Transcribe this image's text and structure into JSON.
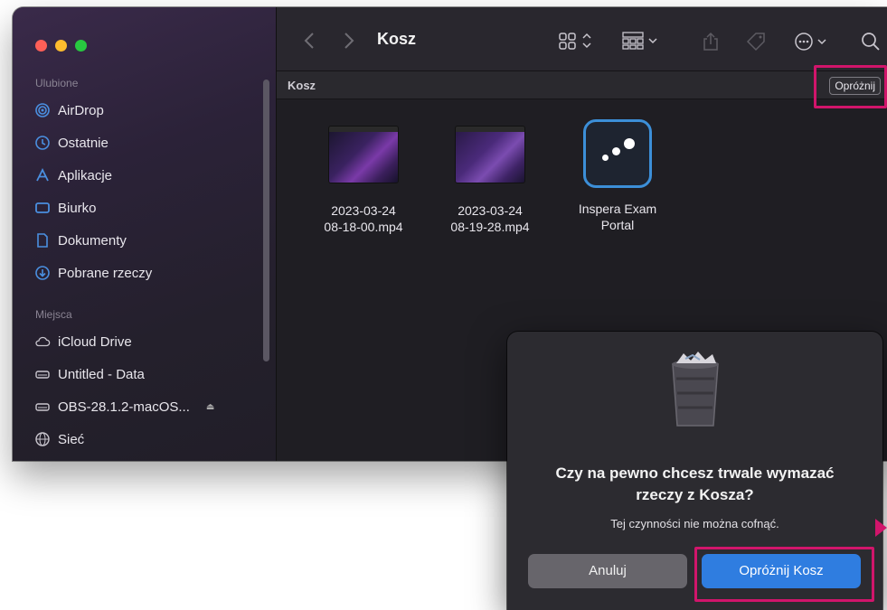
{
  "sidebar": {
    "favorites_header": "Ulubione",
    "favorites": [
      {
        "label": "AirDrop",
        "icon": "airdrop-icon"
      },
      {
        "label": "Ostatnie",
        "icon": "clock-icon"
      },
      {
        "label": "Aplikacje",
        "icon": "apps-icon"
      },
      {
        "label": "Biurko",
        "icon": "desktop-icon"
      },
      {
        "label": "Dokumenty",
        "icon": "document-icon"
      },
      {
        "label": "Pobrane rzeczy",
        "icon": "download-icon"
      }
    ],
    "places_header": "Miejsca",
    "places": [
      {
        "label": "iCloud Drive",
        "icon": "cloud-icon"
      },
      {
        "label": "Untitled - Data",
        "icon": "disk-icon"
      },
      {
        "label": "OBS-28.1.2-macOS...",
        "icon": "disk-icon"
      },
      {
        "label": "Sieć",
        "icon": "network-icon"
      }
    ]
  },
  "toolbar": {
    "title": "Kosz"
  },
  "pathbar": {
    "label": "Kosz",
    "empty_button": "Opróżnij"
  },
  "files": [
    {
      "name_line1": "2023-03-24",
      "name_line2": "08-18-00.mp4"
    },
    {
      "name_line1": "2023-03-24",
      "name_line2": "08-19-28.mp4"
    },
    {
      "name_line1": "Inspera Exam",
      "name_line2": "Portal"
    }
  ],
  "dialog": {
    "title_line1": "Czy na pewno chcesz trwale wymazać",
    "title_line2": "rzeczy z Kosza?",
    "message": "Tej czynności nie można cofnąć.",
    "cancel_label": "Anuluj",
    "confirm_label": "Opróżnij Kosz"
  },
  "colors": {
    "highlight": "#d1156b",
    "accent_button": "#2f7de0"
  }
}
